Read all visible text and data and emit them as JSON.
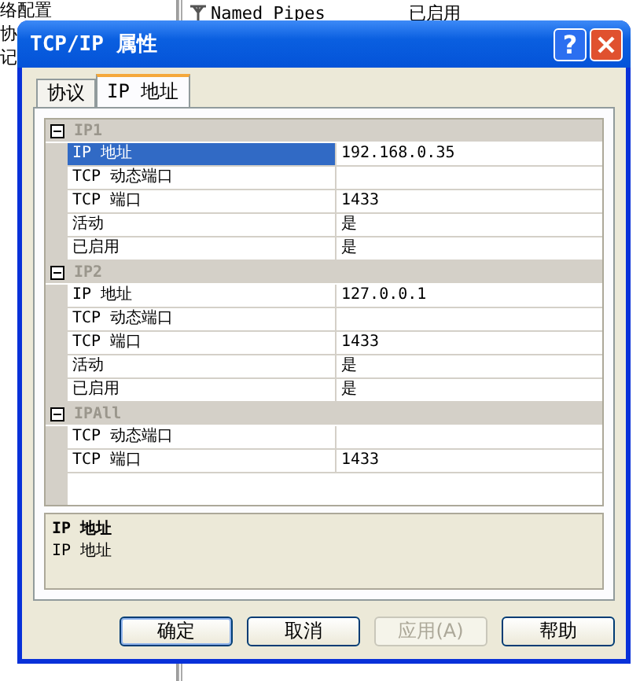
{
  "background": {
    "tree_items": [
      "络配置",
      "协",
      "记"
    ],
    "list_row": {
      "name": "Named Pipes",
      "status": "已启用"
    }
  },
  "dialog": {
    "title": "TCP/IP 属性",
    "help_label": "?",
    "tabs": [
      {
        "label": "协议",
        "selected": false
      },
      {
        "label": "IP 地址",
        "selected": true
      }
    ],
    "groups": [
      {
        "name": "IP1",
        "expanded": true,
        "properties": [
          {
            "name": "IP 地址",
            "value": "192.168.0.35",
            "selected": true
          },
          {
            "name": "TCP 动态端口",
            "selected": false
          },
          {
            "name": "TCP 端口",
            "value": "1433",
            "selected": false
          },
          {
            "name": "活动",
            "value": "是",
            "selected": false
          },
          {
            "name": "已启用",
            "value": "是",
            "selected": false
          }
        ]
      },
      {
        "name": "IP2",
        "expanded": true,
        "properties": [
          {
            "name": "IP 地址",
            "value": "127.0.0.1",
            "selected": false
          },
          {
            "name": "TCP 动态端口",
            "selected": false
          },
          {
            "name": "TCP 端口",
            "value": "1433",
            "selected": false
          },
          {
            "name": "活动",
            "value": "是",
            "selected": false
          },
          {
            "name": "已启用",
            "value": "是",
            "selected": false
          }
        ]
      },
      {
        "name": "IPAll",
        "expanded": true,
        "properties": [
          {
            "name": "TCP 动态端口",
            "selected": false
          },
          {
            "name": "TCP 端口",
            "value": "1433",
            "selected": false
          }
        ]
      }
    ],
    "description": {
      "title": "IP 地址",
      "text": "IP 地址"
    },
    "buttons": [
      {
        "label": "确定",
        "default": true,
        "disabled": false
      },
      {
        "label": "取消",
        "default": false,
        "disabled": false
      },
      {
        "label": "应用(A)",
        "default": false,
        "disabled": true
      },
      {
        "label": "帮助",
        "default": false,
        "disabled": false
      }
    ]
  }
}
